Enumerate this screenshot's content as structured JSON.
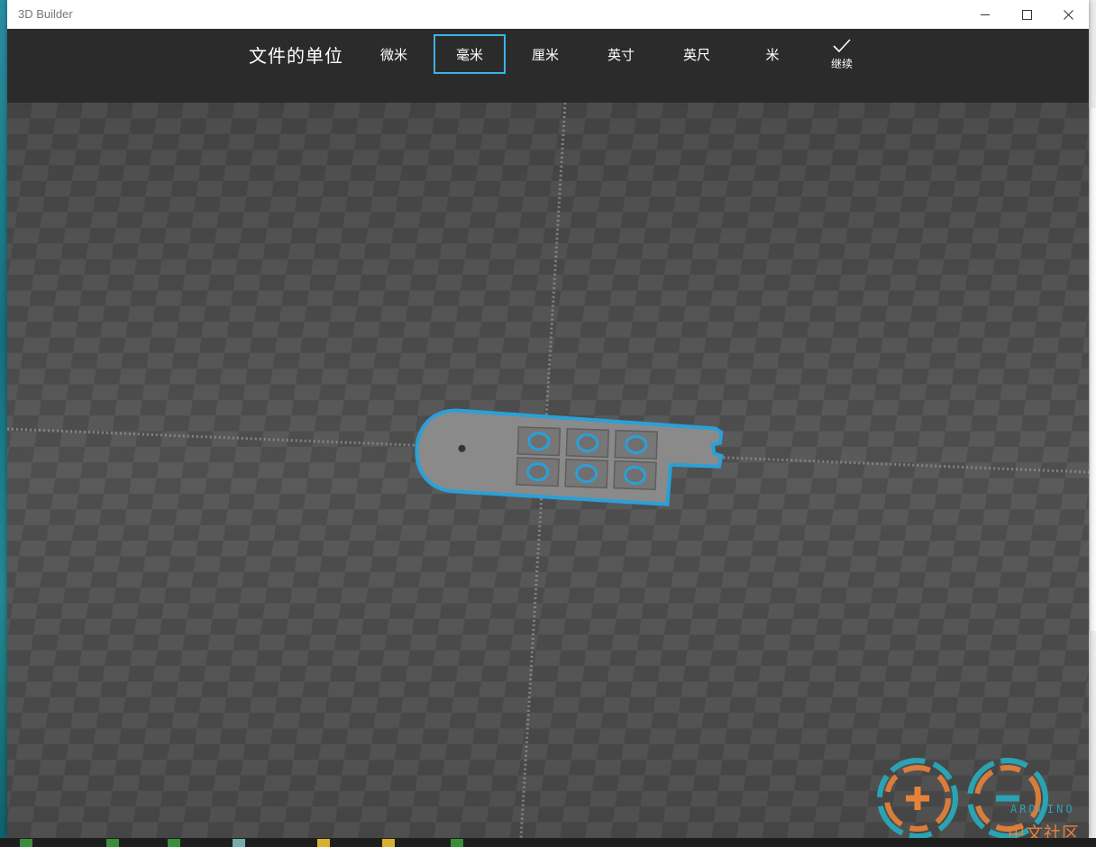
{
  "window": {
    "title": "3D Builder",
    "controls": {
      "minimize": "—",
      "maximize": "☐",
      "close": "✕"
    }
  },
  "toolbar": {
    "heading": "文件的单位",
    "units": [
      {
        "label": "微米",
        "selected": false
      },
      {
        "label": "毫米",
        "selected": true
      },
      {
        "label": "厘米",
        "selected": false
      },
      {
        "label": "英寸",
        "selected": false
      },
      {
        "label": "英尺",
        "selected": false
      },
      {
        "label": "米",
        "selected": false
      }
    ],
    "continue_label": "继续",
    "accent": "#3ab4e6"
  },
  "viewport": {
    "model_outline_color": "#2aa0d8",
    "checker_colors": [
      "#5a5a5a",
      "#4e4e4e"
    ]
  },
  "watermark": {
    "brand": "ARDUINO",
    "cn_text": "中文社区"
  },
  "icons": {
    "continue": "check-icon",
    "minimize": "minimize-icon",
    "maximize": "maximize-icon",
    "close": "close-icon"
  }
}
